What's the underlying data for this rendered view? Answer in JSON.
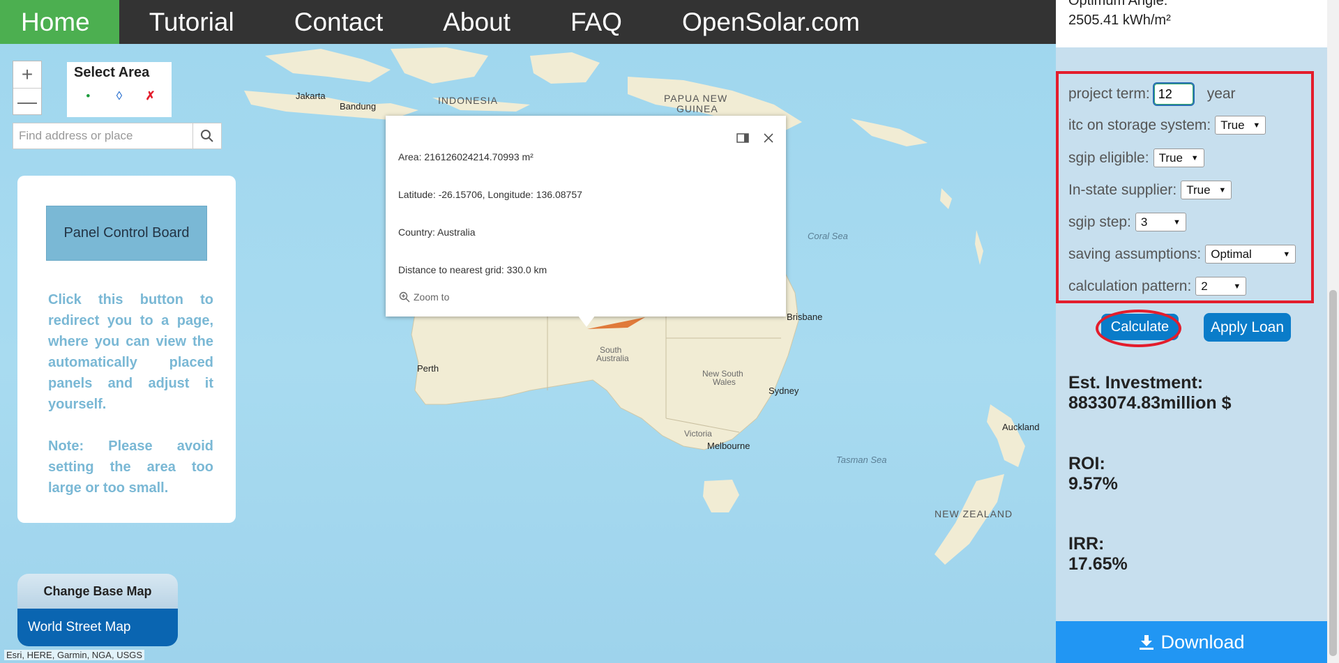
{
  "nav": {
    "items": [
      "Home",
      "Tutorial",
      "Contact",
      "About",
      "FAQ",
      "OpenSolar.com"
    ],
    "active": "Home"
  },
  "zoom": {
    "in_label": "+",
    "out_label": "—"
  },
  "select_area": {
    "title": "Select Area",
    "tools": [
      {
        "symbol": "•",
        "color": "#1a9b3a"
      },
      {
        "symbol": "◊",
        "color": "#1a66cc"
      },
      {
        "symbol": "✗",
        "color": "#e31d2c"
      }
    ]
  },
  "search": {
    "placeholder": "Find address or place"
  },
  "left_panel": {
    "button": "Panel Control Board",
    "text1": "Click this button to redirect you to a page, where you can view the automatically placed panels and adjust it yourself.",
    "text2": "Note: Please avoid setting the area too large or too small."
  },
  "basemap": {
    "title": "Change Base Map",
    "option": "World Street Map"
  },
  "attribution": "Esri, HERE, Garmin, NGA, USGS",
  "map_labels": {
    "jakarta": "Jakarta",
    "bandung": "Bandung",
    "indonesia": "INDONESIA",
    "png_line1": "PAPUA NEW",
    "png_line2": "GUINEA",
    "coral_sea": "Coral Sea",
    "brisbane": "Brisbane",
    "perth": "Perth",
    "sa_line1": "South",
    "sa_line2": "Australia",
    "nsw_line1": "New South",
    "nsw_line2": "Wales",
    "sydney": "Sydney",
    "victoria": "Victoria",
    "melbourne": "Melbourne",
    "tasman": "Tasman Sea",
    "auckland": "Auckland",
    "nz": "NEW ZEALAND"
  },
  "popup": {
    "area": "Area: 216126024214.70993 m²",
    "coords": "Latitude: -26.15706, Longitude: 136.08757",
    "country": "Country: Australia",
    "grid": "Distance to nearest grid: 330.0 km",
    "zoom_to": "Zoom to"
  },
  "right_panel": {
    "optimum_label": "Optimum Angle:",
    "optimum_value": "2505.41 kWh/m²",
    "params": {
      "project_term_label": "project term:",
      "project_term_value": "12",
      "project_term_unit": "year",
      "itc_label": "itc on storage system:",
      "itc_value": "True",
      "sgip_eligible_label": "sgip eligible:",
      "sgip_eligible_value": "True",
      "in_state_label": "In-state supplier:",
      "in_state_value": "True",
      "sgip_step_label": "sgip step:",
      "sgip_step_value": "3",
      "saving_label": "saving assumptions:",
      "saving_value": "Optimal",
      "pattern_label": "calculation pattern:",
      "pattern_value": "2"
    },
    "calculate": "Calculate",
    "apply_loan": "Apply Loan",
    "investment_label": "Est. Investment:",
    "investment_value": "8833074.83million $",
    "roi_label": "ROI:",
    "roi_value": "9.57%",
    "irr_label": "IRR:",
    "irr_value": "17.65%",
    "download": "Download"
  },
  "colors": {
    "nav_bg": "#333333",
    "nav_active": "#4caf50",
    "panel_bg": "#c7dfee",
    "highlight_red": "#e31d2c",
    "button_blue": "#0a7cc9",
    "download_blue": "#2196f3"
  }
}
